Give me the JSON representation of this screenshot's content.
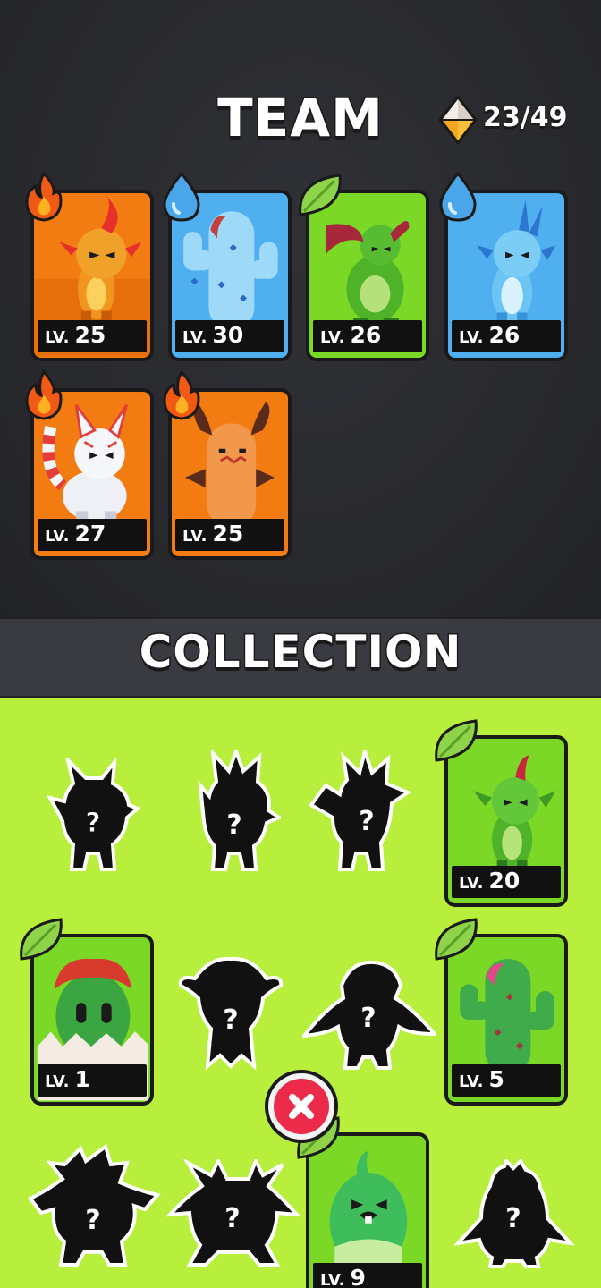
{
  "team": {
    "title": "TEAM",
    "gem_count": "23/49",
    "gem_icon": "diamond-gem-icon",
    "members": [
      {
        "element": "fire",
        "lv_prefix": "LV.",
        "level": "25",
        "creature": "fire-dragon"
      },
      {
        "element": "water",
        "lv_prefix": "LV.",
        "level": "30",
        "creature": "ice-cactus"
      },
      {
        "element": "leaf",
        "lv_prefix": "LV.",
        "level": "26",
        "creature": "leaf-beast"
      },
      {
        "element": "water",
        "lv_prefix": "LV.",
        "level": "26",
        "creature": "water-dragon"
      },
      {
        "element": "fire",
        "lv_prefix": "LV.",
        "level": "27",
        "creature": "fire-fox"
      },
      {
        "element": "fire",
        "lv_prefix": "LV.",
        "level": "25",
        "creature": "fire-cactus"
      }
    ]
  },
  "collection": {
    "title": "COLLECTION",
    "owned": [
      {
        "element": "leaf",
        "lv_prefix": "LV.",
        "level": "20",
        "creature": "leaf-dragon"
      },
      {
        "element": "leaf",
        "lv_prefix": "LV.",
        "level": "1",
        "creature": "hatchling"
      },
      {
        "element": "leaf",
        "lv_prefix": "LV.",
        "level": "5",
        "creature": "cactus"
      },
      {
        "element": "leaf",
        "lv_prefix": "LV.",
        "level": "9",
        "creature": "leaf-bird"
      }
    ],
    "unknown_mark": "?",
    "remove_icon": "close-icon"
  },
  "colors": {
    "fire": "#f07a10",
    "water": "#49a8ea",
    "leaf": "#7cd827",
    "collection_bg": "#b8ef3c",
    "team_bg": "#2b2c31",
    "remove": "#ec2b4a"
  }
}
